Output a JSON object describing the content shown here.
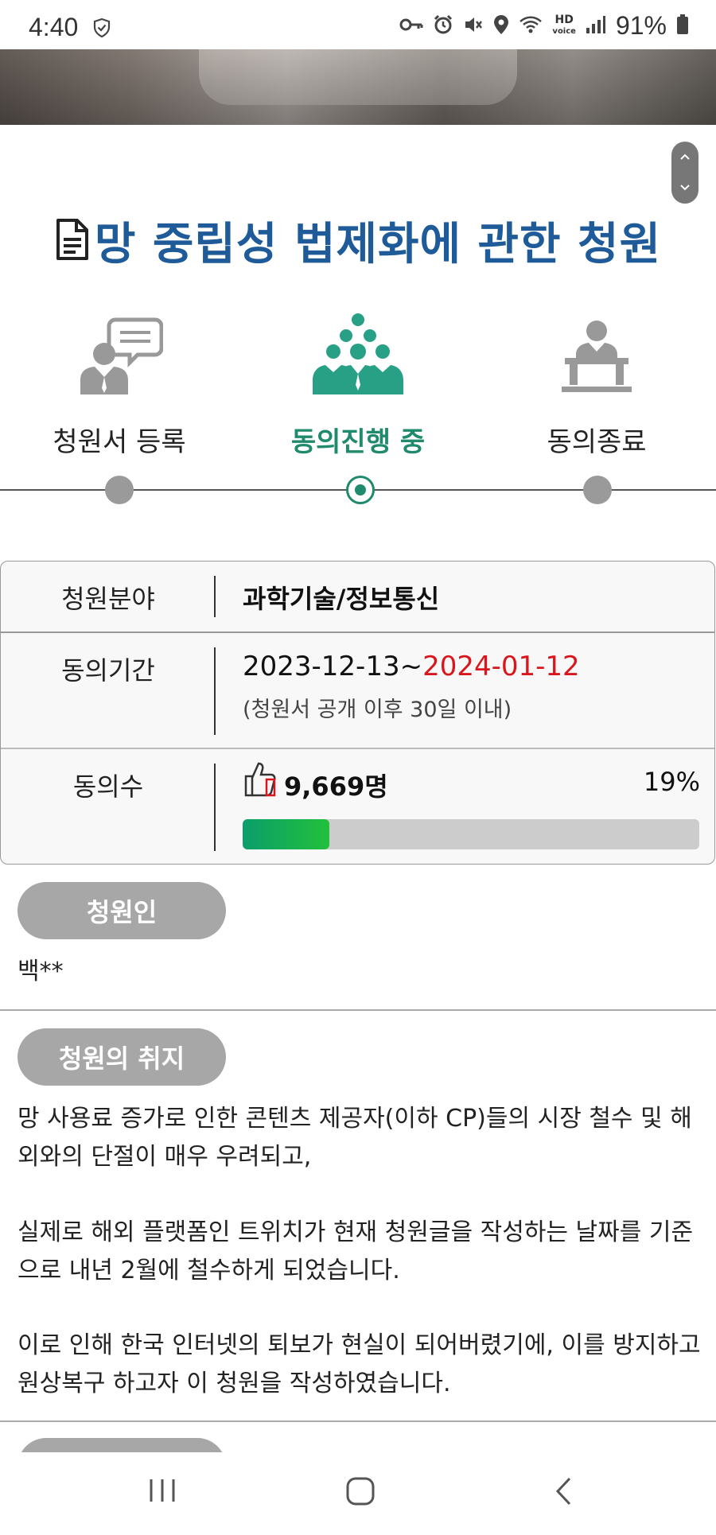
{
  "status_bar": {
    "time": "4:40",
    "battery_percent": "91%",
    "hd_top": "HD",
    "hd_bottom": "voice",
    "icons": [
      "shield-check-icon",
      "key-icon",
      "alarm-icon",
      "mute-icon",
      "location-icon",
      "wifi-icon",
      "hd-voice-icon",
      "signal-icon",
      "battery-icon"
    ]
  },
  "page": {
    "title": "망 중립성 법제화에 관한 청원"
  },
  "steps": [
    {
      "label": "청원서 등록",
      "active": false
    },
    {
      "label": "동의진행 중",
      "active": true
    },
    {
      "label": "동의종료",
      "active": false
    }
  ],
  "info": {
    "field_label": "청원분야",
    "field_value": "과학기술/정보통신",
    "period_label": "동의기간",
    "period_start": "2023-12-13~",
    "period_end": "2024-01-12",
    "period_note": "(청원서 공개 이후 30일 이내)",
    "count_label": "동의수",
    "count_value": "9,669명",
    "count_percent": "19%",
    "progress_fraction": 0.19
  },
  "petitioner": {
    "label": "청원인",
    "name": "백**"
  },
  "purpose": {
    "label": "청원의 취지",
    "paragraph_1": "망 사용료 증가로 인한 콘텐츠 제공자(이하 CP)들의 시장 철수 및 해외와의 단절이 매우 우려되고,",
    "paragraph_2": "실제로 해외 플랫폼인 트위치가 현재 청원글을 작성하는 날짜를 기준으로 내년 2월에 철수하게 되었습니다.",
    "paragraph_3": "이로 인해 한국 인터넷의 퇴보가 현실이 되어버렸기에, 이를 방지하고 원상복구 하고자 이 청원을 작성하였습니다."
  },
  "colors": {
    "title_blue": "#1f5b99",
    "active_green": "#1f8a6c",
    "deadline_red": "#d8161b",
    "pill_gray": "#a7a7a7"
  }
}
